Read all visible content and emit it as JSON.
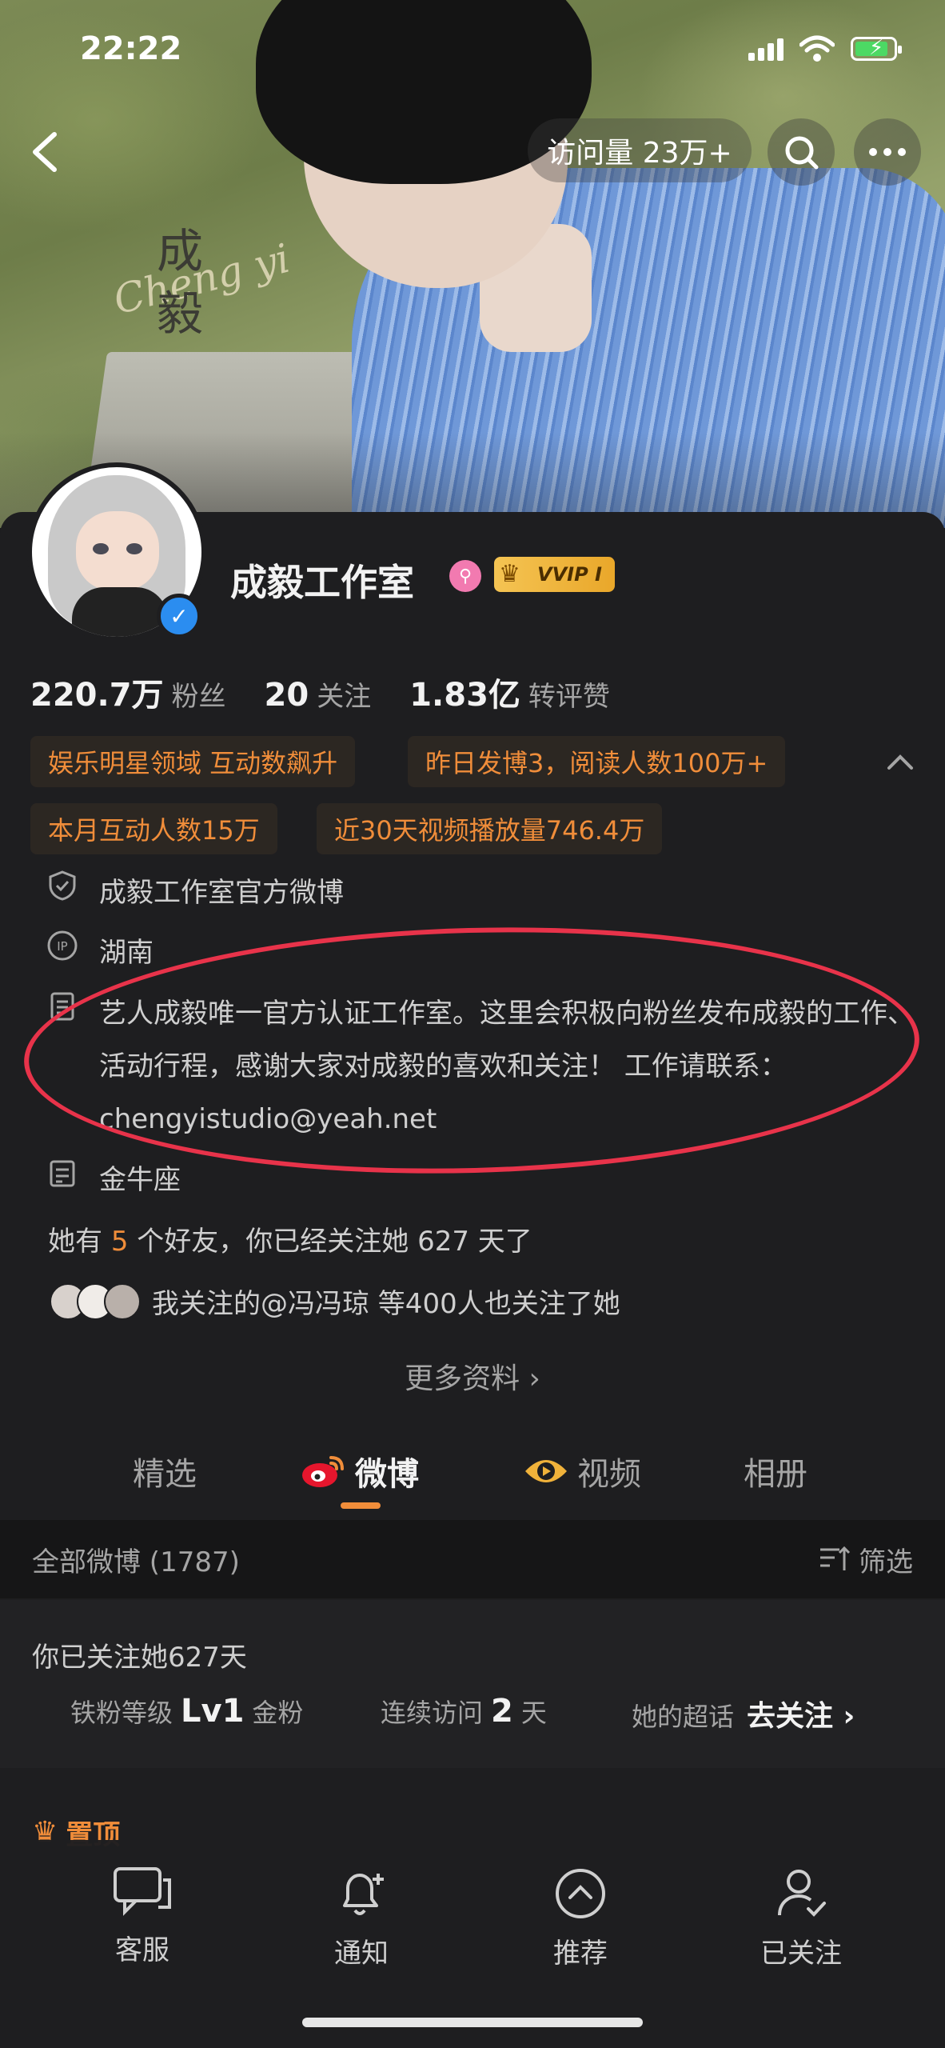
{
  "status_bar": {
    "time": "22:22"
  },
  "header": {
    "visits": "访问量 23万+"
  },
  "cover": {
    "title_chars": [
      "成",
      "毅"
    ],
    "script_text": "Cheng yi"
  },
  "profile": {
    "name": "成毅工作室",
    "vip_label": "VVIP I",
    "stats": [
      {
        "value": "220.7万",
        "label": "粉丝"
      },
      {
        "value": "20",
        "label": "关注"
      },
      {
        "value": "1.83亿",
        "label": "转评赞"
      }
    ],
    "tags": [
      "娱乐明星领域 互动数飙升",
      "昨日发博3，阅读人数100万+",
      "本月互动人数15万",
      "近30天视频播放量746.4万"
    ],
    "verification": "成毅工作室官方微博",
    "ip_location": "湖南",
    "bio": "艺人成毅唯一官方认证工作室。这里会积极向粉丝发布成毅的工作、活动行程，感谢大家对成毅的喜欢和关注！  工作请联系：chengyistudio@yeah.net",
    "zodiac": "金牛座",
    "friends": {
      "prefix": "她有 ",
      "count": "5",
      "suffix": " 个好友，你已经关注她 627 天了"
    },
    "mutual_follow": "我关注的@冯冯琼  等400人也关注了她",
    "more_info": "更多资料 ›"
  },
  "tabs": [
    {
      "label": "精选"
    },
    {
      "label": "微博"
    },
    {
      "label": "视频"
    },
    {
      "label": "相册"
    }
  ],
  "feed": {
    "all_label": "全部微博 (1787)",
    "filter_label": "筛选"
  },
  "fan_card": {
    "title": "你已关注她627天",
    "level_label": "铁粉等级",
    "level_value": "Lv1",
    "level_suffix": "金粉",
    "visit_label": "连续访问",
    "visit_value": "2",
    "visit_suffix": "天",
    "super_label": "她的超话",
    "super_action": "去关注 ›"
  },
  "pinned_label": "置顶",
  "bottom_bar": [
    {
      "label": "客服",
      "icon": "chat-icon"
    },
    {
      "label": "通知",
      "icon": "bell-plus-icon"
    },
    {
      "label": "推荐",
      "icon": "chevron-up-circle-icon"
    },
    {
      "label": "已关注",
      "icon": "user-check-icon"
    }
  ],
  "colors": {
    "accent": "#f08d3a",
    "background": "#1e1e20",
    "annotation": "#e8334a",
    "verify": "#2b8df0"
  }
}
